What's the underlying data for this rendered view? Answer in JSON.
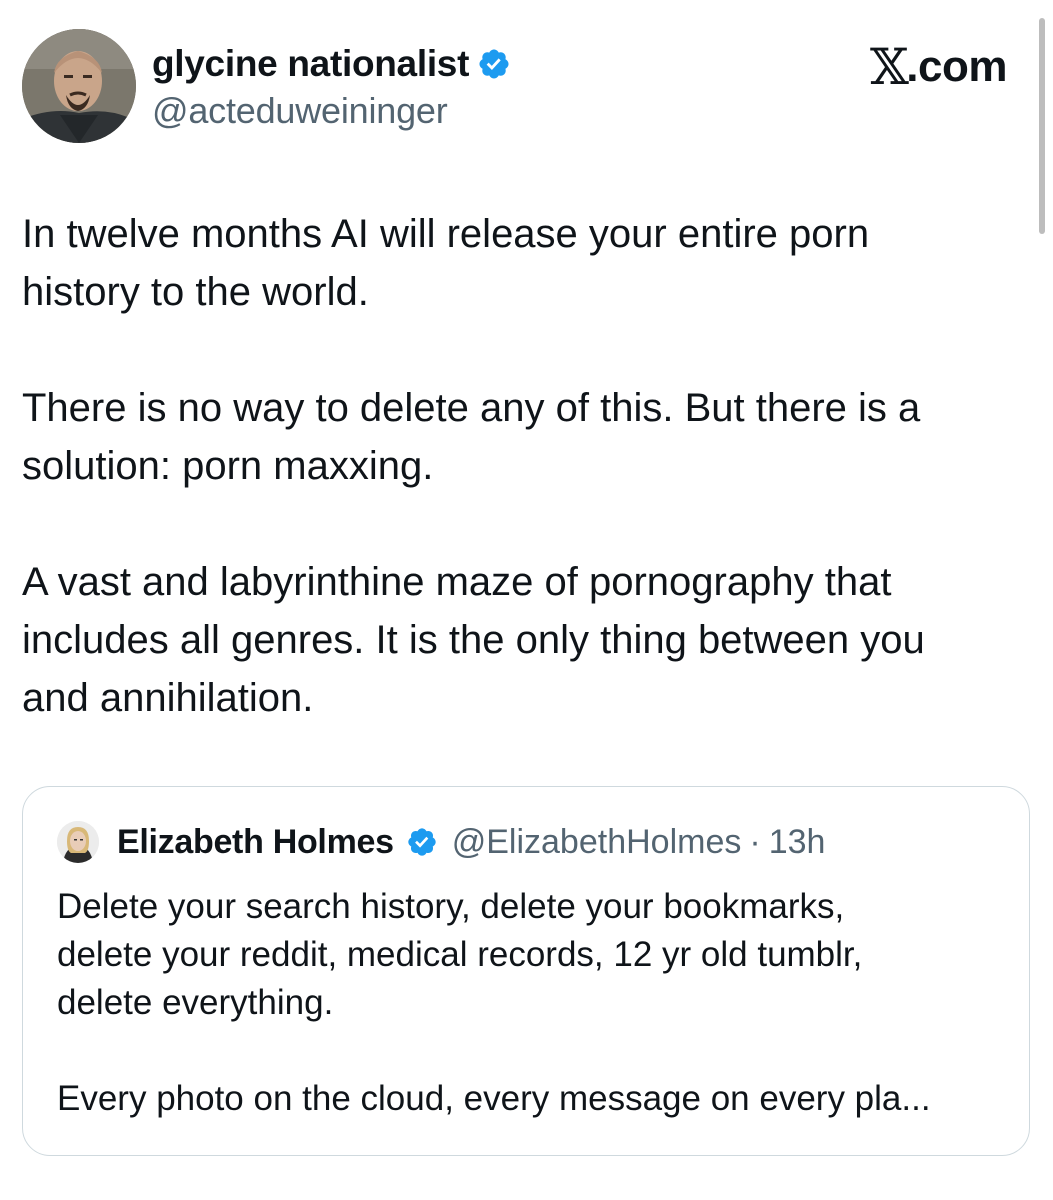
{
  "site": {
    "logo_glyph": "𝕏",
    "logo_suffix": ".com"
  },
  "tweet": {
    "author": {
      "display_name": "glycine nationalist",
      "handle": "@acteduweininger",
      "verified": true,
      "avatar_icon": "avatar-bald-man-goatee"
    },
    "paragraphs": [
      "In twelve months AI will release your entire porn\nhistory to the world.",
      "There is no way to delete any of this. But there is a\nsolution: porn maxxing.",
      "A vast and labyrinthine maze of pornography that\nincludes all genres. It is the only thing between you\nand annihilation."
    ]
  },
  "quoted_tweet": {
    "author": {
      "display_name": "Elizabeth Holmes",
      "handle": "@ElizabethHolmes",
      "separator": "·",
      "time": "13h",
      "verified": true,
      "avatar_icon": "avatar-blonde-woman"
    },
    "paragraphs": [
      "Delete your search history, delete your bookmarks,\ndelete your reddit, medical records, 12 yr old tumblr,\ndelete everything.",
      "Every photo on the cloud, every message on every pla..."
    ]
  },
  "colors": {
    "text_primary": "#0f1419",
    "text_secondary": "#536471",
    "verified_blue": "#1d9bf0",
    "card_border": "#cfd9de"
  }
}
